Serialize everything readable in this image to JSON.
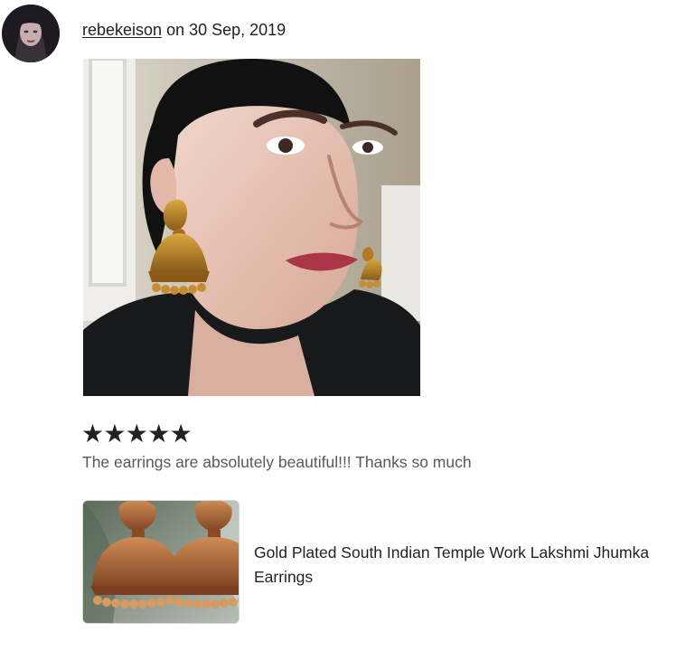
{
  "review": {
    "username": "rebekeison",
    "date_prefix": " on ",
    "date": "30 Sep, 2019",
    "stars": [
      "★",
      "★",
      "★",
      "★",
      "★"
    ],
    "rating_value": 5,
    "rating_max": 5,
    "text": "The earrings are absolutely beautiful!!! Thanks so much"
  },
  "product": {
    "title": "Gold Plated South Indian Temple Work Lakshmi Jhumka Earrings"
  },
  "icons": {
    "avatar": "avatar",
    "review_photo": "review-photo",
    "star": "star-icon",
    "product_thumbnail": "product-thumbnail"
  },
  "colors": {
    "text_primary": "#222222",
    "text_secondary": "#595959",
    "star": "#222222"
  }
}
